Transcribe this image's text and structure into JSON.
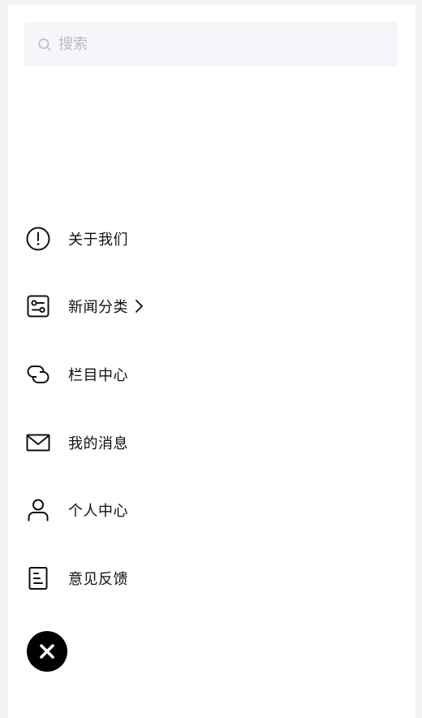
{
  "search": {
    "placeholder": "搜索",
    "value": "",
    "icon": "search-icon"
  },
  "menu": {
    "items": [
      {
        "label": "关于我们",
        "icon": "info-circle-icon"
      },
      {
        "label": "新闻分类",
        "icon": "settings-sliders-icon",
        "has_chevron": true
      },
      {
        "label": "栏目中心",
        "icon": "link-icon"
      },
      {
        "label": "我的消息",
        "icon": "mail-icon"
      },
      {
        "label": "个人中心",
        "icon": "user-icon"
      },
      {
        "label": "意见反馈",
        "icon": "document-icon"
      }
    ]
  },
  "close": {
    "icon": "close-icon"
  },
  "colors": {
    "panel_background": "#ffffff",
    "search_background": "#f5f6fa",
    "placeholder_color": "#b9bcc4",
    "close_button": "#000000"
  }
}
